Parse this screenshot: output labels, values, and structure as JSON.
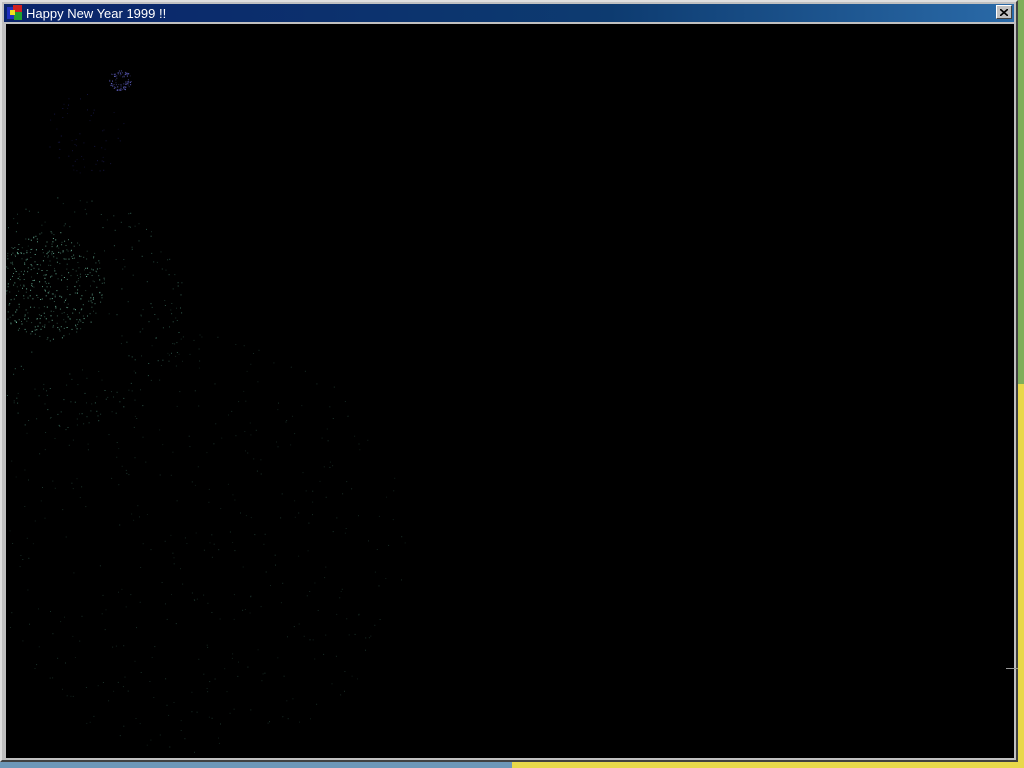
{
  "window": {
    "title": "Happy New Year 1999 !!",
    "icon": "app-icon",
    "close_icon": "close-icon"
  },
  "scene": {
    "name": "fireworks-animation",
    "background_color": "#000000",
    "fireworks": [
      {
        "name": "firework-blue",
        "color": "#6b6bd8"
      },
      {
        "name": "firework-teal",
        "color": "#7fd8b8"
      },
      {
        "name": "firework-sparkle-trail",
        "color": "#3a6a5a"
      }
    ]
  },
  "colors": {
    "titlebar_start": "#0a246a",
    "titlebar_end": "#2a6aa8",
    "window_face": "#c0c0c0"
  }
}
